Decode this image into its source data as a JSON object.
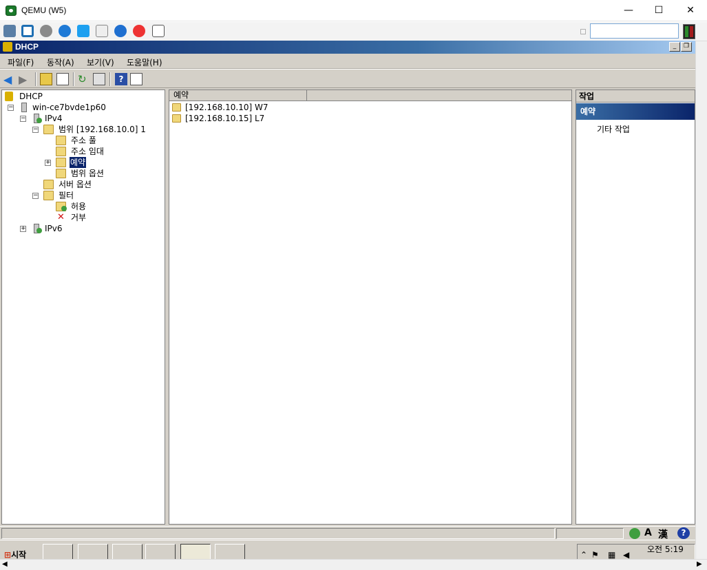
{
  "host": {
    "title": "QEMU (W5)",
    "minimize": "—",
    "maximize": "☐",
    "close": "✕",
    "toolbar_icons": [
      "cubes-icon",
      "fullscreen-icon",
      "gear-icon",
      "refresh-icon",
      "windows-icon",
      "document-icon",
      "info-icon",
      "stop-icon",
      "eject-icon"
    ]
  },
  "window": {
    "title": "DHCP",
    "min_label": "_",
    "restore_label": "❐"
  },
  "menubar": {
    "file": "파일(F)",
    "action": "동작(A)",
    "view": "보기(V)",
    "help": "도움말(H)"
  },
  "tree": {
    "root": "DHCP",
    "server": "win-ce7bvde1p60",
    "ipv4": "IPv4",
    "scope": "범위 [192.168.10.0] 1",
    "address_pool": "주소 풀",
    "address_leases": "주소 임대",
    "reservations": "예약",
    "scope_options": "범위 옵션",
    "server_options": "서버 옵션",
    "filters": "필터",
    "allow": "허용",
    "deny": "거부",
    "ipv6": "IPv6"
  },
  "list": {
    "column": "예약",
    "rows": [
      "[192.168.10.10] W7",
      "[192.168.10.15] L7"
    ]
  },
  "actions": {
    "header": "작업",
    "section": "예약",
    "more": "기타 작업"
  },
  "statusbar": {
    "ime_a": "A",
    "ime_han": "漢"
  },
  "taskbar": {
    "start": "시작",
    "clock_time": "오전 5:19"
  }
}
